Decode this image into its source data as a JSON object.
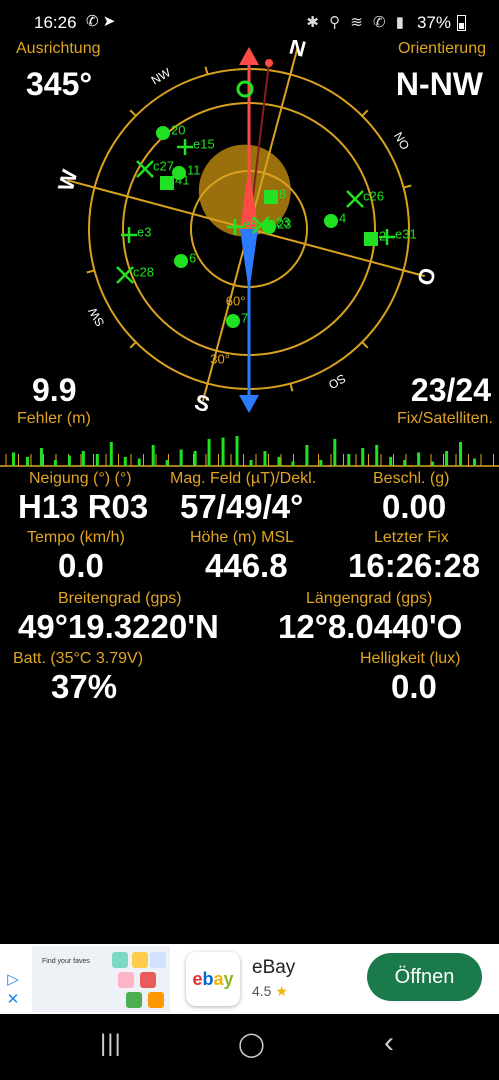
{
  "status_bar": {
    "time": "16:26",
    "battery": "37%",
    "left_icons": "✆ ➤",
    "right_icons": "✱ ⚲ ≋ ✆ ▮"
  },
  "header": {
    "heading_label": "Ausrichtung",
    "heading_value": "345°",
    "orientation_label": "Orientierung",
    "orientation_value": "N-NW"
  },
  "compass": {
    "cardinals": {
      "n": "N",
      "s": "S",
      "w": "W",
      "o": "O"
    },
    "intercardinals": {
      "nw": "NW",
      "no": "NO",
      "sw": "SW",
      "so": "SO"
    },
    "rings": {
      "r60": "60°",
      "r30": "30°"
    },
    "satellites": [
      {
        "id": "20",
        "shape": "circle"
      },
      {
        "id": "e15",
        "shape": "plus"
      },
      {
        "id": "c27",
        "shape": "cross"
      },
      {
        "id": "11",
        "shape": "circle"
      },
      {
        "id": "41",
        "shape": "square"
      },
      {
        "id": "e3",
        "shape": "plus"
      },
      {
        "id": "c28",
        "shape": "cross"
      },
      {
        "id": "6",
        "shape": "circle"
      },
      {
        "id": "7",
        "shape": "circle"
      },
      {
        "id": "8",
        "shape": "square"
      },
      {
        "id": "4",
        "shape": "circle"
      },
      {
        "id": "c26",
        "shape": "cross"
      },
      {
        "id": "e31",
        "shape": "plus"
      },
      {
        "id": "e5",
        "shape": "plus"
      },
      {
        "id": "c23",
        "shape": "cross"
      },
      {
        "id": "23",
        "shape": "circle"
      },
      {
        "id": "2",
        "shape": "square"
      }
    ],
    "colors": {
      "ring": "#d9a21e",
      "sat": "#22e022",
      "north": "#ff4a4a",
      "south": "#2a7bff",
      "accent": "#e0a422"
    }
  },
  "accuracy": {
    "value": "9.9",
    "label": "Fehler (m)"
  },
  "fix": {
    "value": "23/24",
    "label": "Fix/Satelliten."
  },
  "signal_levels": [
    0.45,
    0.3,
    0.6,
    0.2,
    0.35,
    0.5,
    0.4,
    0.8,
    0.3,
    0.25,
    0.7,
    0.2,
    0.55,
    0.5,
    0.9,
    0.95,
    1.0,
    0.2,
    0.5,
    0.3,
    0.15,
    0.7,
    0.2,
    0.9,
    0.4,
    0.6,
    0.7,
    0.3,
    0.2,
    0.45,
    0.15,
    0.5,
    0.8,
    0.25
  ],
  "metrics": {
    "tilt_label": "Neigung (°) (°)",
    "tilt_value": "H13 R03",
    "mag_label": "Mag. Feld (µT)/Dekl.",
    "mag_value": "57/49/4°",
    "accel_label": "Beschl. (g)",
    "accel_value": "0.00",
    "speed_label": "Tempo (km/h)",
    "speed_value": "0.0",
    "altitude_label": "Höhe (m) MSL",
    "altitude_value": "446.8",
    "lastfix_label": "Letzter Fix",
    "lastfix_value": "16:26:28",
    "lat_label": "Breitengrad (gps)",
    "lat_value": "49°19.3220'N",
    "lon_label": "Längengrad (gps)",
    "lon_value": "12°8.0440'O",
    "batt_label": "Batt. (35°C 3.79V)",
    "batt_value": "37%",
    "lux_label": "Helligkeit (lux)",
    "lux_value": "0.0"
  },
  "ad": {
    "adchoice_top": "▷",
    "adchoice_close": "✕",
    "thumb_text": "Find your faves",
    "logo_text": "ebay",
    "app_name": "eBay",
    "rating": "4.5",
    "rating_star": "★",
    "open_label": "Öffnen"
  },
  "nav": {
    "recents": "|||",
    "home": "◯",
    "back": "‹"
  }
}
